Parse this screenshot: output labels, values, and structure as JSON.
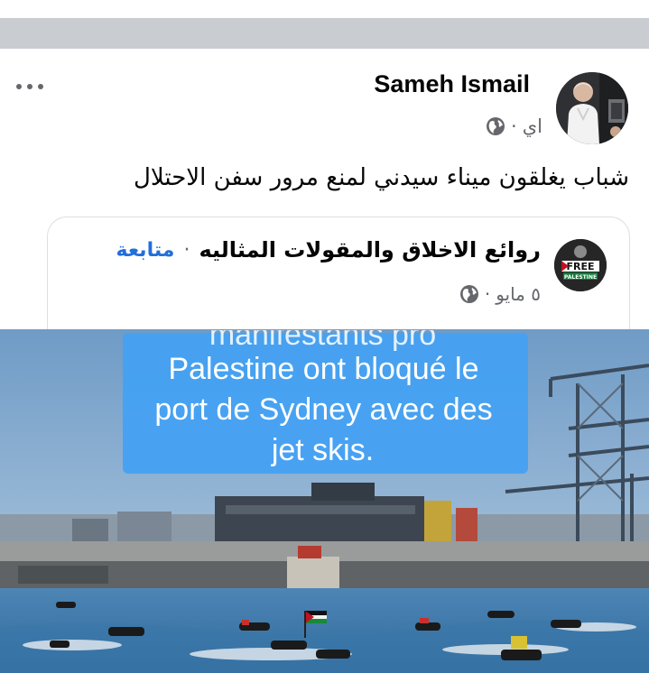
{
  "post": {
    "author": "Sameh Ismail",
    "time": "اي",
    "separator": "·",
    "text": "شباب يغلقون ميناء سيدني لمنع مرور سفن الاحتلال",
    "icons": {
      "more": "more-options-icon",
      "privacy": "globe-icon"
    }
  },
  "shared": {
    "page_name": "روائع  الاخلاق والمقولات المثاليه",
    "separator": "·",
    "follow_label": "متابعة",
    "date": "٥ مايو",
    "date_separator": "·",
    "avatar_text": "FREE PALESTINE"
  },
  "video": {
    "caption_lines": [
      "manifestants pro",
      "Palestine ont bloqué le",
      "port de Sydney avec des",
      "jet skis."
    ]
  },
  "colors": {
    "band": "#c9ccd1",
    "follow": "#216fdb",
    "secondary_text": "#65676b",
    "caption_bg": "#45a1f2"
  }
}
